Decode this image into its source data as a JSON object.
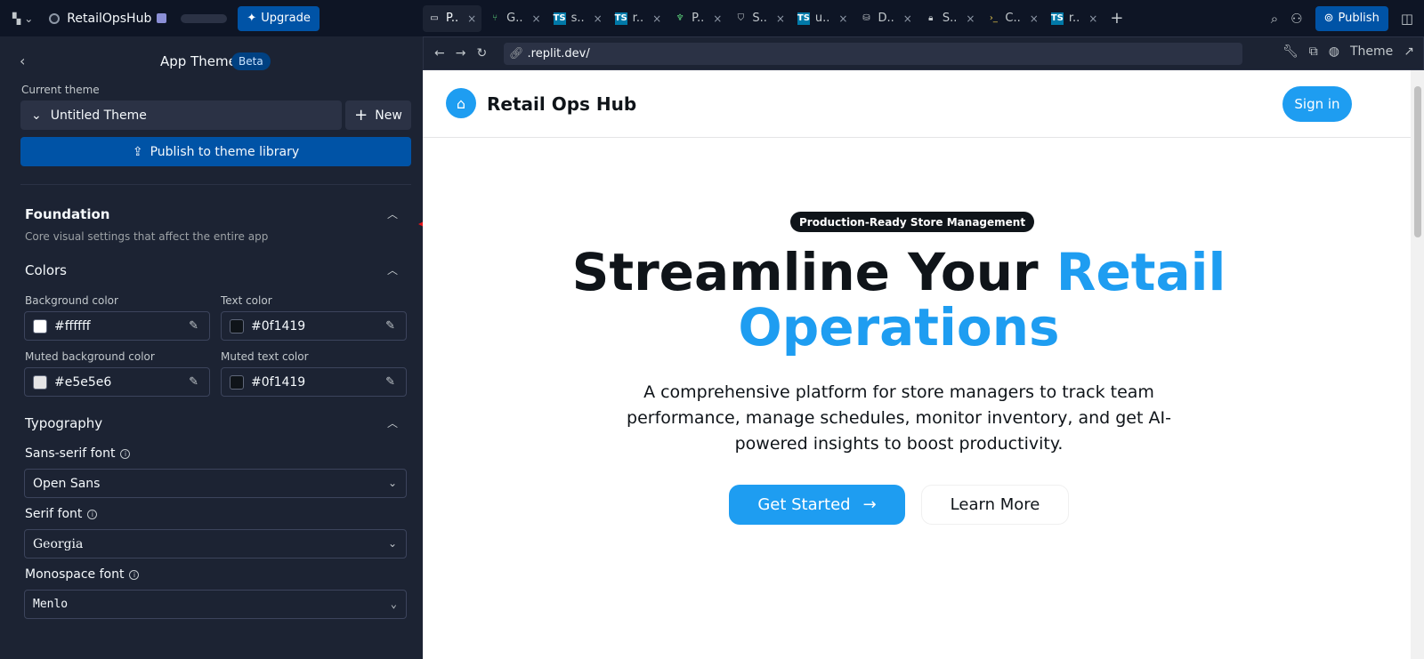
{
  "topbar": {
    "repl_name": "RetailOpsHub",
    "upgrade_label": "Upgrade",
    "publish_label": "Publish",
    "tabs": [
      {
        "label": "P..",
        "icon": "monitor-icon",
        "active": true
      },
      {
        "label": "G..",
        "icon": "git-icon"
      },
      {
        "label": "s..",
        "icon": "ts-file-icon"
      },
      {
        "label": "r..",
        "icon": "ts-file-icon"
      },
      {
        "label": "P..",
        "icon": "postgres-icon"
      },
      {
        "label": "S..",
        "icon": "shield-icon"
      },
      {
        "label": "u..",
        "icon": "ts-file-icon"
      },
      {
        "label": "D..",
        "icon": "database-icon"
      },
      {
        "label": "S..",
        "icon": "lock-icon"
      },
      {
        "label": "C..",
        "icon": "console-icon"
      },
      {
        "label": "r..",
        "icon": "ts-file-icon"
      }
    ],
    "ts_icon_text": "TS"
  },
  "sidebar": {
    "title": "App Theme",
    "beta": "Beta",
    "current_theme_label": "Current theme",
    "theme_name": "Untitled Theme",
    "new_label": "New",
    "publish_library_label": "Publish to theme library",
    "foundation": {
      "title": "Foundation",
      "description": "Core visual settings that affect the entire app"
    },
    "colors": {
      "title": "Colors",
      "background_label": "Background color",
      "background_value": "#ffffff",
      "text_label": "Text color",
      "text_value": "#0f1419",
      "muted_bg_label": "Muted background color",
      "muted_bg_value": "#e5e5e6",
      "muted_text_label": "Muted text color",
      "muted_text_value": "#0f1419"
    },
    "typography": {
      "title": "Typography",
      "sans_label": "Sans-serif font",
      "sans_value": "Open Sans",
      "serif_label": "Serif font",
      "serif_value": "Georgia",
      "mono_label": "Monospace font",
      "mono_value": "Menlo"
    }
  },
  "preview": {
    "url": ".replit.dev/",
    "theme_label": "Theme",
    "brand": "Retail Ops Hub",
    "signin": "Sign in",
    "badge": "Production-Ready Store Management",
    "hero_title_dark": "Streamline Your ",
    "hero_title_accent1": "Retail",
    "hero_title_accent2": "Operations",
    "hero_sub": "A comprehensive platform for store managers to track team performance, manage schedules, monitor inventory, and get AI-powered insights to boost productivity.",
    "cta_primary": "Get Started",
    "cta_secondary": "Learn More",
    "accent_color": "#1e9df1"
  }
}
